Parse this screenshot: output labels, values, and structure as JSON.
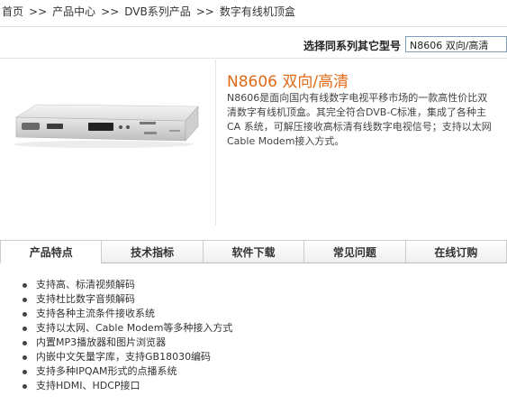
{
  "breadcrumb": {
    "items": [
      "首页",
      "产品中心",
      "DVB系列产品",
      "数字有线机顶盒"
    ],
    "separator": ">>"
  },
  "model_selector": {
    "label": "选择同系列其它型号",
    "value": "N8606 双向/高清"
  },
  "product": {
    "title": "N8606 双向/高清",
    "description_lines": [
      "N8606是面向国内有线数字电视平移市场的一款高性价比双",
      "清数字有线机顶盒。其完全符合DVB-C标准，集成了各种主",
      "CA 系统，可解压接收高标清有线数字电视信号；支持以太网",
      "Cable Modem接入方式。"
    ],
    "image_alt": "set-top box"
  },
  "tabs": [
    {
      "label": "产品特点",
      "active": true
    },
    {
      "label": "技术指标",
      "active": false
    },
    {
      "label": "软件下载",
      "active": false
    },
    {
      "label": "常见问题",
      "active": false
    },
    {
      "label": "在线订购",
      "active": false
    }
  ],
  "features": [
    "支持高、标清视频解码",
    "支持杜比数字音频解码",
    "支持各种主流条件接收系统",
    "支持以太网、Cable Modem等多种接入方式",
    "内置MP3播放器和图片浏览器",
    "内嵌中文矢量字库，支持GB18030编码",
    "支持多种IPQAM形式的点播系统",
    "支持HDMI、HDCP接口"
  ],
  "colors": {
    "title": "#e06a16",
    "text": "#333333"
  }
}
